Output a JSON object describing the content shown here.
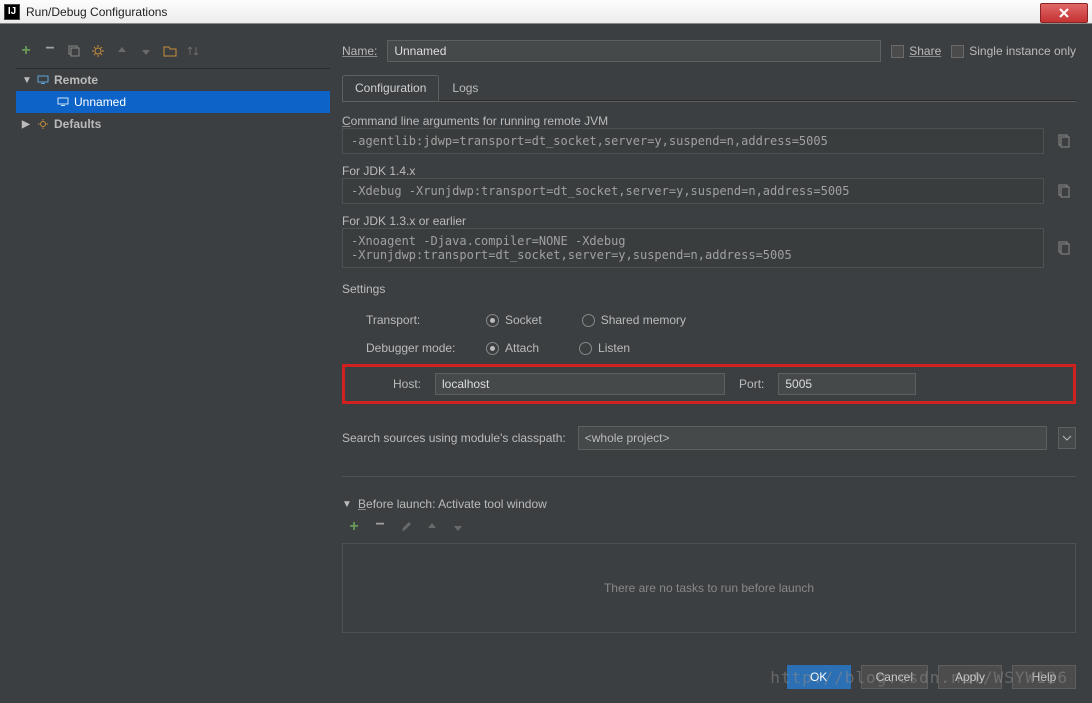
{
  "window": {
    "title": "Run/Debug Configurations"
  },
  "tree": {
    "remote_label": "Remote",
    "unnamed_label": "Unnamed",
    "defaults_label": "Defaults"
  },
  "name": {
    "label": "Name:",
    "value": "Unnamed"
  },
  "share": {
    "label": "Share"
  },
  "single_instance": {
    "label": "Single instance only"
  },
  "tabs": {
    "configuration": "Configuration",
    "logs": "Logs"
  },
  "cmd": {
    "label": "Command line arguments for running remote JVM",
    "value": "-agentlib:jdwp=transport=dt_socket,server=y,suspend=n,address=5005"
  },
  "jdk14": {
    "label": "For JDK 1.4.x",
    "value": "-Xdebug -Xrunjdwp:transport=dt_socket,server=y,suspend=n,address=5005"
  },
  "jdk13": {
    "label": "For JDK 1.3.x or earlier",
    "value": "-Xnoagent -Djava.compiler=NONE -Xdebug\n-Xrunjdwp:transport=dt_socket,server=y,suspend=n,address=5005"
  },
  "settings": {
    "title": "Settings",
    "transport_label": "Transport:",
    "socket": "Socket",
    "shared_memory": "Shared memory",
    "debugger_mode_label": "Debugger mode:",
    "attach": "Attach",
    "listen": "Listen",
    "host_label": "Host:",
    "host_value": "localhost",
    "port_label": "Port:",
    "port_value": "5005"
  },
  "classpath": {
    "label": "Search sources using module's classpath:",
    "value": "<whole project>"
  },
  "before": {
    "title": "Before launch: Activate tool window",
    "empty": "There are no tasks to run before launch"
  },
  "buttons": {
    "ok": "OK",
    "cancel": "Cancel",
    "apply": "Apply",
    "help": "Help"
  },
  "watermark": "http://blog.csdn.net/WSYW126"
}
